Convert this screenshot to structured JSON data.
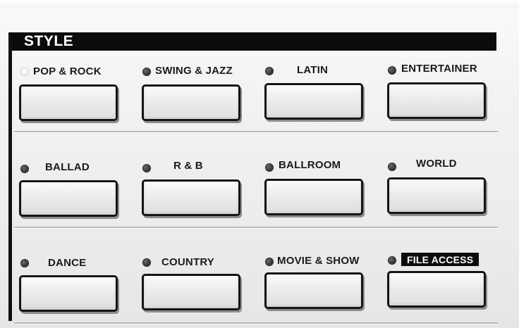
{
  "panel": {
    "title": "STYLE"
  },
  "buttons": [
    {
      "label": "POP & ROCK",
      "lit": true
    },
    {
      "label": "SWING & JAZZ",
      "lit": false
    },
    {
      "label": "LATIN",
      "lit": false
    },
    {
      "label": "ENTERTAINER",
      "lit": false
    },
    {
      "label": "BALLAD",
      "lit": false
    },
    {
      "label": "R & B",
      "lit": false
    },
    {
      "label": "BALLROOM",
      "lit": false
    },
    {
      "label": "WORLD",
      "lit": false
    },
    {
      "label": "DANCE",
      "lit": false
    },
    {
      "label": "COUNTRY",
      "lit": false
    },
    {
      "label": "MOVIE & SHOW",
      "lit": false
    },
    {
      "label": "FILE ACCESS",
      "lit": false,
      "inverse_label": true
    }
  ],
  "colors": {
    "panel": "#f1f1f1",
    "bar": "#0c0c0c",
    "led_off": "#303030",
    "led_on": "#ffffff"
  }
}
